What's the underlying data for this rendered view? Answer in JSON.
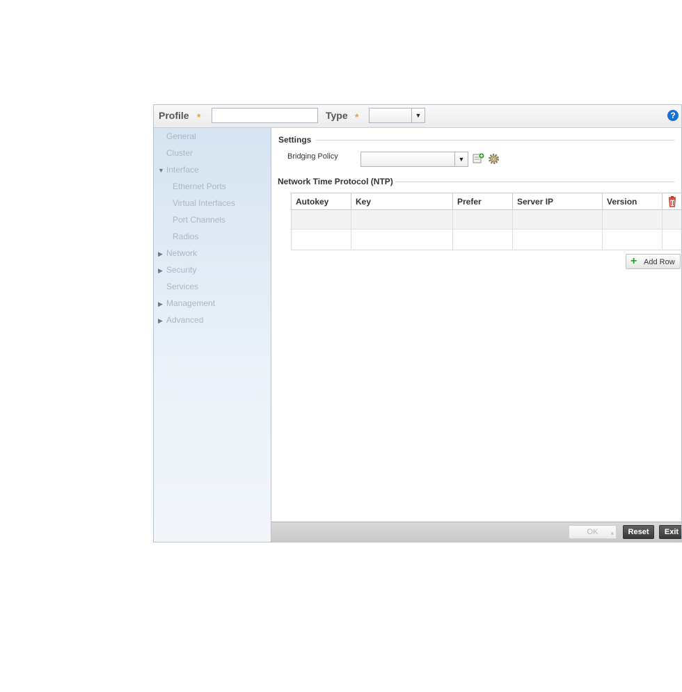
{
  "header": {
    "profile_label": "Profile",
    "profile_required": "*",
    "profile_value": "",
    "type_label": "Type",
    "type_required": "*",
    "type_value": "",
    "help_icon": "help-icon",
    "help_glyph": "?"
  },
  "sidebar": {
    "items": [
      {
        "label": "General",
        "expander": ""
      },
      {
        "label": "Cluster",
        "expander": ""
      },
      {
        "label": "Interface",
        "expander": "▼"
      },
      {
        "label": "Ethernet Ports",
        "expander": ""
      },
      {
        "label": "Virtual Interfaces",
        "expander": ""
      },
      {
        "label": "Port Channels",
        "expander": ""
      },
      {
        "label": "Radios",
        "expander": ""
      },
      {
        "label": "Network",
        "expander": "▶"
      },
      {
        "label": "Security",
        "expander": "▶"
      },
      {
        "label": "Services",
        "expander": ""
      },
      {
        "label": "Management",
        "expander": "▶"
      },
      {
        "label": "Advanced",
        "expander": "▶"
      }
    ]
  },
  "settings": {
    "title": "Settings",
    "bridging_policy_label": "Bridging Policy",
    "bridging_policy_value": ""
  },
  "ntp": {
    "title": "Network Time Protocol (NTP)",
    "columns": [
      "Autokey",
      "Key",
      "Prefer",
      "Server IP",
      "Version"
    ],
    "rows": [
      [
        "",
        "",
        "",
        "",
        ""
      ],
      [
        "",
        "",
        "",
        "",
        ""
      ]
    ],
    "add_row_label": "Add Row"
  },
  "footer": {
    "ok_label": "OK",
    "reset_label": "Reset",
    "exit_label": "Exit"
  },
  "colors": {
    "accent_star": "#f0a030",
    "help_blue": "#1a6fd1",
    "delete_red": "#c0392b",
    "add_green": "#2aa02a"
  }
}
